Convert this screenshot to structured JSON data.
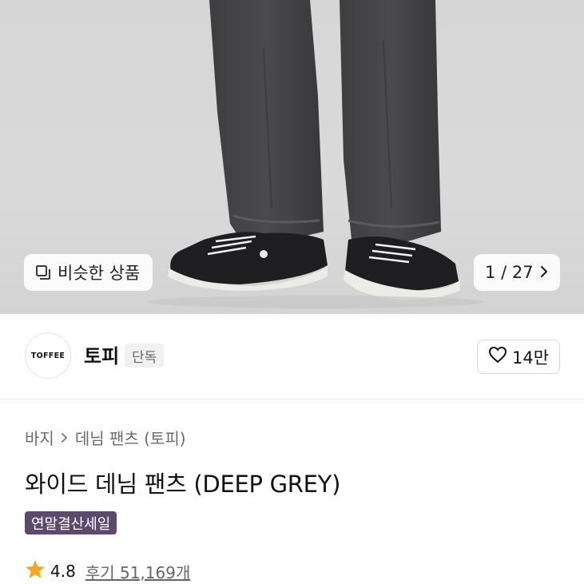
{
  "gallery": {
    "similar_label": "비슷한 상품",
    "current": "1",
    "separator": "/",
    "total": "27",
    "similar_icon": "copy-icon",
    "next_icon": "chevron-right-icon"
  },
  "brand": {
    "logo_text": "TOFFEE",
    "name": "토피",
    "badge": "단독",
    "likes": "14만",
    "like_icon": "heart-icon"
  },
  "breadcrumb": {
    "items": [
      "바지",
      "데님 팬츠 (토피)"
    ]
  },
  "product": {
    "title": "와이드 데님 팬츠 (DEEP GREY)",
    "tag": "연말결산세일",
    "rating": "4.8",
    "reviews": "후기 51,169개"
  },
  "colors": {
    "tag_bg": "#5b4a6b",
    "star": "#f5a623"
  }
}
